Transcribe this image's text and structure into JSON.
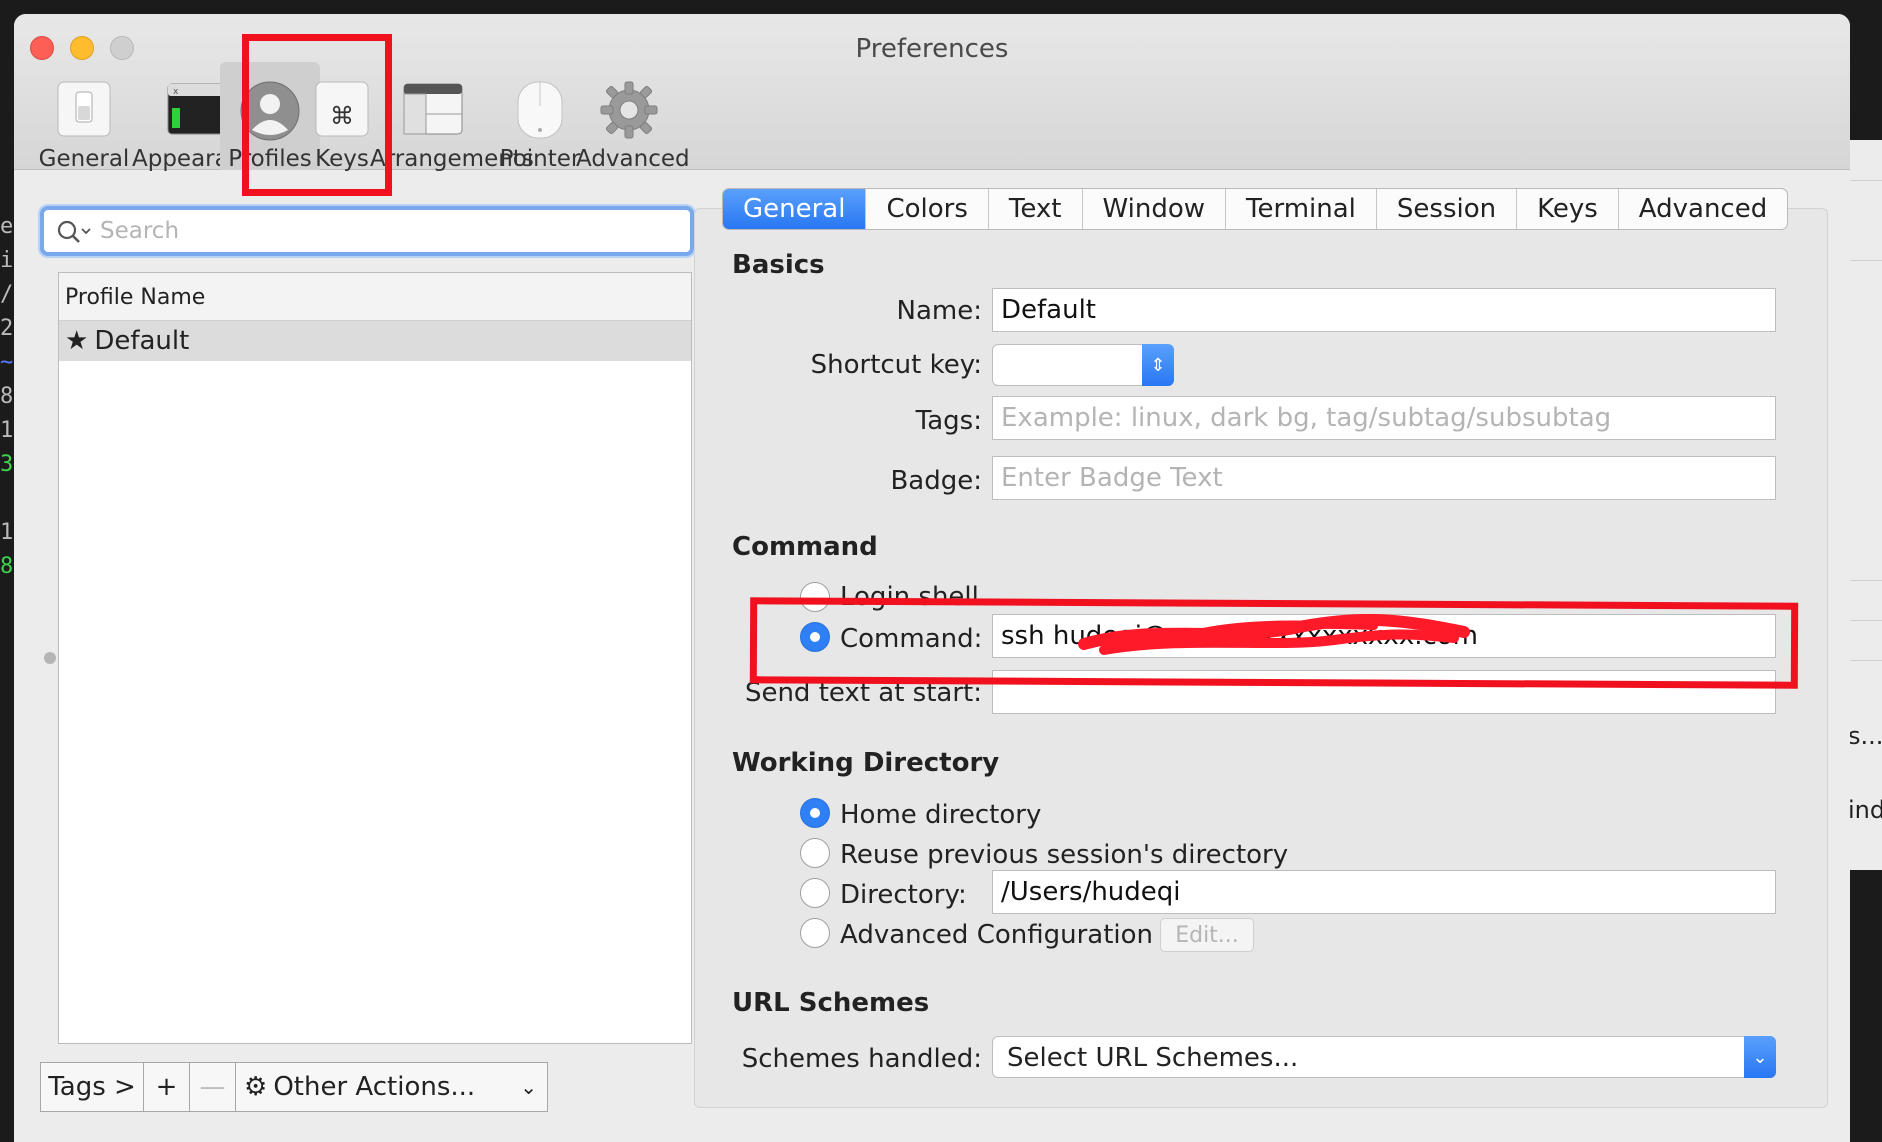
{
  "window": {
    "title": "Preferences"
  },
  "toolbar": {
    "items": [
      {
        "label": "General",
        "icon": "general-switch-icon"
      },
      {
        "label": "Appearance",
        "icon": "appearance-window-icon"
      },
      {
        "label": "Profiles",
        "icon": "person-icon",
        "selected": true
      },
      {
        "label": "Keys",
        "icon": "command-key-icon"
      },
      {
        "label": "Arrangements",
        "icon": "arrangements-window-icon"
      },
      {
        "label": "Pointer",
        "icon": "mouse-icon"
      },
      {
        "label": "Advanced",
        "icon": "gear-icon"
      }
    ]
  },
  "sidebar": {
    "search_placeholder": "Search",
    "column_header": "Profile Name",
    "profiles": [
      {
        "name": "Default",
        "starred": true
      }
    ],
    "bottom": {
      "tags": "Tags >",
      "add": "+",
      "remove": "—",
      "other_actions": "Other Actions..."
    }
  },
  "tabs": [
    "General",
    "Colors",
    "Text",
    "Window",
    "Terminal",
    "Session",
    "Keys",
    "Advanced"
  ],
  "basics": {
    "heading": "Basics",
    "name_label": "Name:",
    "name_value": "Default",
    "shortcut_label": "Shortcut key:",
    "tags_label": "Tags:",
    "tags_placeholder": "Example: linux, dark bg, tag/subtag/subsubtag",
    "badge_label": "Badge:",
    "badge_placeholder": "Enter Badge Text"
  },
  "command": {
    "heading": "Command",
    "login_shell": "Login shell",
    "command_label": "Command:",
    "command_value": "ssh hudeqi@xxxxxxxxxxxxxxxx.com",
    "send_text_label": "Send text at start:",
    "send_text_value": ""
  },
  "working_directory": {
    "heading": "Working Directory",
    "home": "Home directory",
    "reuse": "Reuse previous session's directory",
    "directory_label": "Directory:",
    "directory_value": "/Users/hudeqi",
    "advanced": "Advanced Configuration",
    "edit": "Edit..."
  },
  "url_schemes": {
    "heading": "URL Schemes",
    "label": "Schemes handled:",
    "value": "Select URL Schemes..."
  },
  "background": {
    "right_fragment_1": "s...",
    "right_fragment_2": "ind"
  },
  "colors": {
    "accent": "#2f7ff5",
    "annotation": "#f0101e",
    "redaction": "#ff1a2a"
  }
}
